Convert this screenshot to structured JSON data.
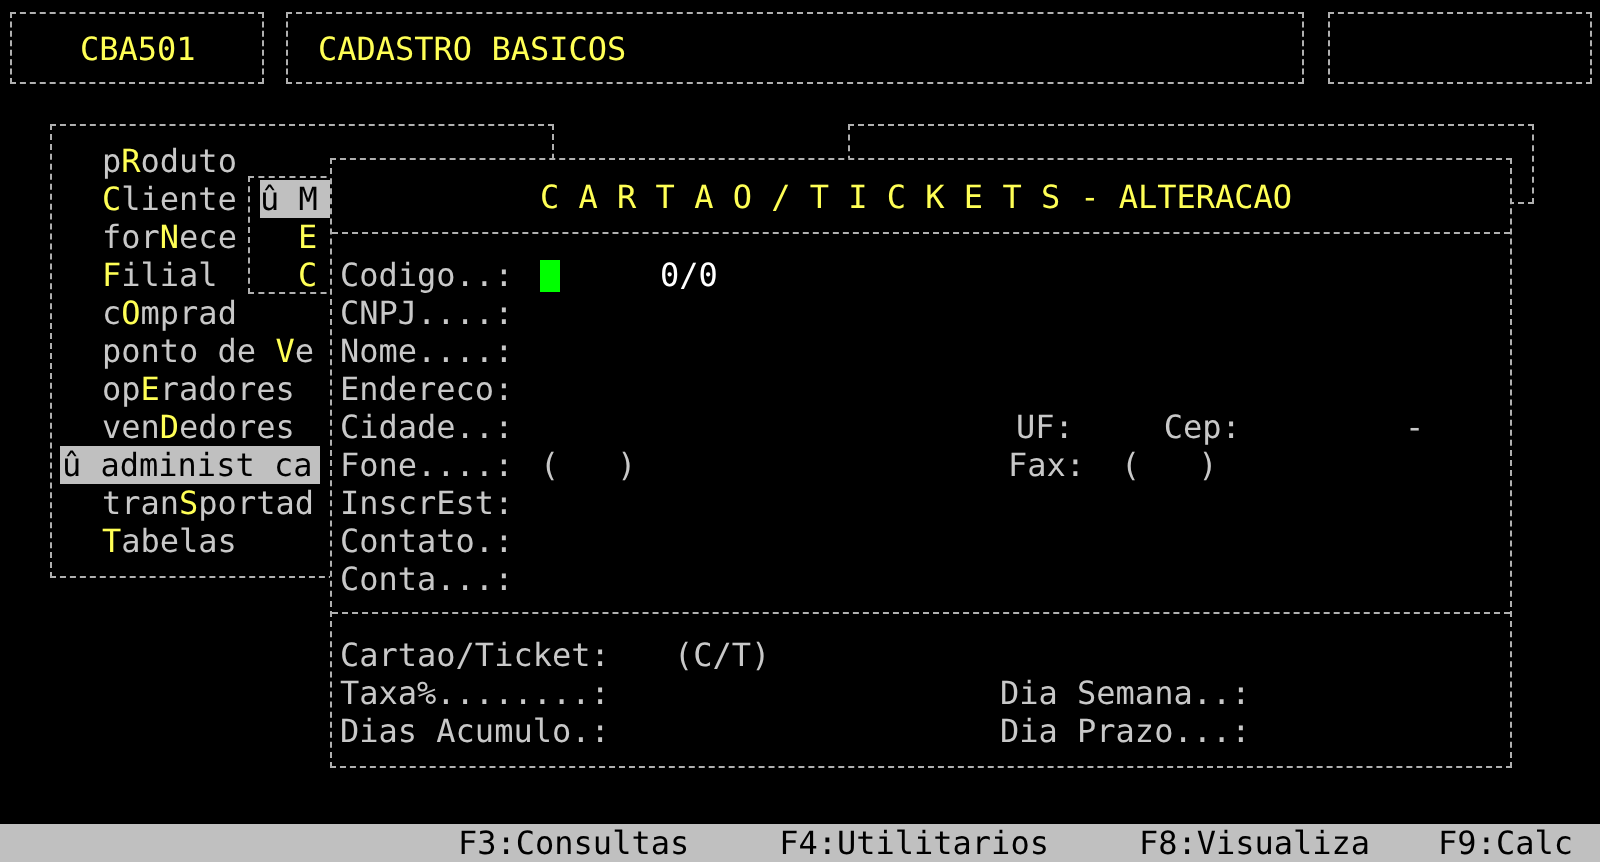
{
  "header": {
    "code": "CBA501",
    "title": "CADASTRO BASICOS"
  },
  "menu": {
    "items": [
      {
        "before": "p",
        "hotkey": "R",
        "after": "oduto",
        "selected": false
      },
      {
        "hotkey": "C",
        "after": "liente",
        "selected": false
      },
      {
        "before": "for",
        "hotkey": "N",
        "after": "ece",
        "selected": false
      },
      {
        "hotkey": "F",
        "after": "ilial",
        "selected": false
      },
      {
        "before": "c",
        "hotkey": "O",
        "after": "mprad",
        "selected": false
      },
      {
        "before": "ponto de ",
        "hotkey": "V",
        "after": "e",
        "selected": false
      },
      {
        "before": "op",
        "hotkey": "E",
        "after": "radores",
        "selected": false
      },
      {
        "before": "ven",
        "hotkey": "D",
        "after": "edores",
        "selected": false
      },
      {
        "before": "û administ ca",
        "selected": true
      },
      {
        "before": "tran",
        "hotkey": "S",
        "after": "portad",
        "selected": false
      },
      {
        "hotkey": "T",
        "after": "abelas",
        "selected": false
      }
    ]
  },
  "submenu": {
    "items": [
      {
        "text": "û M",
        "selected": true
      },
      {
        "text": "E",
        "selected": false
      },
      {
        "text": "C",
        "selected": false
      }
    ]
  },
  "form": {
    "title": "C A R T A O / T I C K E T S",
    "mode": "- ALTERACAO",
    "fields": [
      {
        "kind": "code",
        "label": "Codigo..:",
        "cursor": true,
        "value": "0/0"
      },
      {
        "kind": "plain",
        "label": "CNPJ....:"
      },
      {
        "kind": "plain",
        "label": "Nome....:"
      },
      {
        "kind": "plain",
        "label": "Endereco:"
      },
      {
        "kind": "city",
        "label": "Cidade..:",
        "uf_label": "UF:",
        "cep_label": "Cep:",
        "cep_value": "-"
      },
      {
        "kind": "phone",
        "label": "Fone....:",
        "value": "(   )",
        "fax_label": "Fax:",
        "fax_value": "(   )"
      },
      {
        "kind": "plain",
        "label": "InscrEst:"
      },
      {
        "kind": "plain",
        "label": "Contato.:"
      },
      {
        "kind": "plain",
        "label": "Conta...:"
      }
    ],
    "card_fields": [
      {
        "left_label": "Cartao/Ticket:",
        "left_value": "(C/T)"
      },
      {
        "left_label": "Taxa%........:",
        "right_label": "Dia Semana..:"
      },
      {
        "left_label": "Dias Acumulo.:",
        "right_label": "Dia Prazo...:"
      }
    ]
  },
  "status_bar": [
    "F3:Consultas",
    "F4:Utilitarios",
    "F8:Visualiza",
    "F9:Calc"
  ]
}
